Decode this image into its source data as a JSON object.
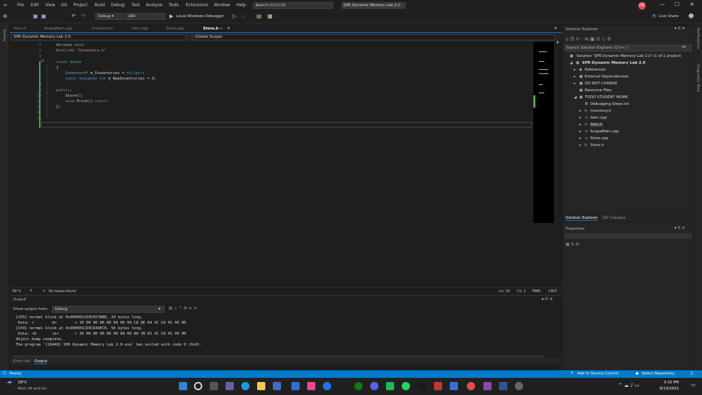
{
  "menu": {
    "items": [
      "File",
      "Edit",
      "View",
      "Git",
      "Project",
      "Build",
      "Debug",
      "Test",
      "Analyze",
      "Tools",
      "Extensions",
      "Window",
      "Help"
    ],
    "search_placeholder": "Search (Ctrl+Q)",
    "solution_title": "SPR Dynamic Memory Lab 2.0",
    "avatar": "DE",
    "live_share": "Live Share"
  },
  "toolbar": {
    "config": "Debug",
    "platform": "x64",
    "debugger": "Local Windows Debugger"
  },
  "side": {
    "toolbox": "Toolbox",
    "notifications": "Notifications",
    "diagnostic": "Diagnostic Tools"
  },
  "editor": {
    "tabs": [
      "Item.h",
      "ScopeMain.cpp",
      "Inventory.h",
      "Item.cpp",
      "Store.cpp",
      "Store.h"
    ],
    "active_tab": "Store.h",
    "project_dd": "SPR Dynamic Memory Lab 2.0",
    "scope_dd": "(Global Scope)",
    "line_numbers": [
      "1",
      "2",
      "3",
      "4",
      "5",
      "6",
      "7",
      "8",
      "9",
      "10",
      "11",
      "12",
      "13",
      "14"
    ],
    "lines": [
      {
        "parts": [
          {
            "t": "#pragma once",
            "c": "#9b9b9b"
          }
        ]
      },
      {
        "parts": [
          {
            "t": "#include ",
            "c": "#9b9b9b"
          },
          {
            "t": "\"Inventory.h\"",
            "c": "#d69d85"
          }
        ]
      },
      {
        "parts": []
      },
      {
        "parts": [
          {
            "t": "class ",
            "c": "#569cd6"
          },
          {
            "t": "Store",
            "c": "#4ec9b0"
          }
        ]
      },
      {
        "parts": [
          {
            "t": "{",
            "c": "#dcdcdc"
          }
        ]
      },
      {
        "parts": [
          {
            "t": "    Inventory",
            "c": "#4ec9b0"
          },
          {
            "t": "* ",
            "c": "#dcdcdc"
          },
          {
            "t": "m_Inventories",
            "c": "#dadada"
          },
          {
            "t": " = ",
            "c": "#dcdcdc"
          },
          {
            "t": "nullptr",
            "c": "#569cd6"
          },
          {
            "t": ";",
            "c": "#dcdcdc"
          }
        ]
      },
      {
        "parts": [
          {
            "t": "    const unsigned int ",
            "c": "#569cd6"
          },
          {
            "t": "m_NumInventories",
            "c": "#dadada"
          },
          {
            "t": " = 3;",
            "c": "#dcdcdc"
          }
        ]
      },
      {
        "parts": []
      },
      {
        "parts": [
          {
            "t": "public",
            "c": "#569cd6"
          },
          {
            "t": ":",
            "c": "#dcdcdc"
          }
        ]
      },
      {
        "parts": [
          {
            "t": "    Store",
            "c": "#dcdcaa"
          },
          {
            "t": "();",
            "c": "#dcdcdc"
          }
        ]
      },
      {
        "parts": [
          {
            "t": "    void ",
            "c": "#569cd6"
          },
          {
            "t": "Print",
            "c": "#dcdcaa"
          },
          {
            "t": "() ",
            "c": "#dcdcdc"
          },
          {
            "t": "const",
            "c": "#569cd6"
          },
          {
            "t": ";",
            "c": "#dcdcdc"
          }
        ]
      },
      {
        "parts": [
          {
            "t": "};",
            "c": "#dcdcdc"
          }
        ]
      },
      {
        "parts": []
      },
      {
        "parts": []
      }
    ],
    "zoom": "99 %",
    "issues": "No issues found",
    "ln": "Ln: 14",
    "ch": "Ch: 1",
    "tabs_mode": "TABS",
    "eol": "CRLF"
  },
  "solution_explorer": {
    "title": "Solution Explorer",
    "search_placeholder": "Search Solution Explorer (Ctrl+;)",
    "solution": "Solution 'SPR Dynamic Memory Lab 2.0' (1 of 1 project)",
    "project": "SPR Dynamic Memory Lab 2.0",
    "items": [
      "References",
      "External Dependencies",
      "DO NOT CHANGE",
      "Resource Files",
      "TODO STUDENT WORK",
      "Debugging Steps.txt",
      "Inventory.h",
      "Item.cpp",
      "Item.h",
      "ScopeMain.cpp",
      "Store.cpp",
      "Store.h"
    ],
    "tab1": "Solution Explorer",
    "tab2": "Git Changes"
  },
  "properties": {
    "title": "Properties"
  },
  "output": {
    "title": "Output",
    "show_from_label": "Show output from:",
    "source": "Debug",
    "lines": [
      "{155} normal block at 0x000001CD3C657B80, 24 bytes long.",
      " Data: <        d<        > 10 00 00 00 00 00 00 00 C8 AE 64 3C CD 01 00 00",
      "{154} normal block at 0x000001CD3C64AEC0, 56 bytes long.",
      " Data: <0       (e<       > 30 00 00 00 00 00 00 00 88 7B 65 3C CD 01 00 00",
      "Object dump complete.",
      "The program '[29440] SPR Dynamic Memory Lab 2.0.exe' has exited with code 0 (0x0)."
    ],
    "tab_errors": "Error List",
    "tab_output": "Output"
  },
  "status": {
    "ready": "Ready",
    "add_source": "Add to Source Control",
    "select_repo": "Select Repository"
  },
  "taskbar": {
    "temp": "28°C",
    "weather": "Rain off and on",
    "time": "3:15 PM",
    "date": "9/13/2022"
  }
}
